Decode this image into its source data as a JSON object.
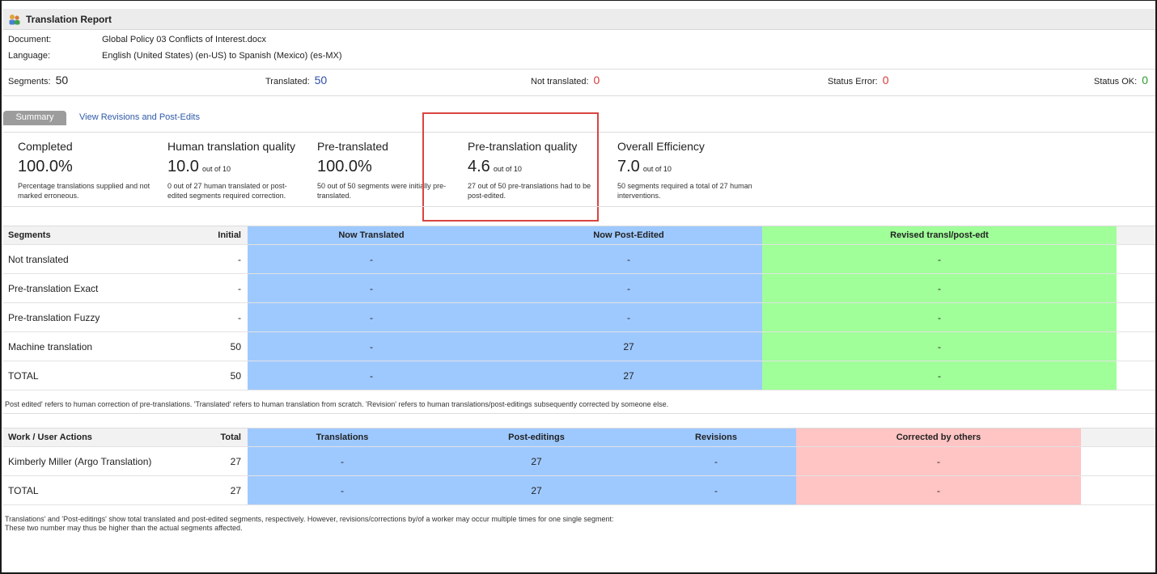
{
  "window": {
    "title": "Translation Report"
  },
  "info": {
    "document_label": "Document:",
    "document_value": "Global Policy 03 Conflicts of Interest.docx",
    "language_label": "Language:",
    "language_value": "English (United States) (en-US) to Spanish (Mexico) (es-MX)"
  },
  "stats": {
    "segments_label": "Segments:",
    "segments_value": "50",
    "translated_label": "Translated:",
    "translated_value": "50",
    "not_translated_label": "Not translated:",
    "not_translated_value": "0",
    "status_error_label": "Status Error:",
    "status_error_value": "0",
    "status_ok_label": "Status OK:",
    "status_ok_value": "0"
  },
  "tabs": {
    "summary": "Summary",
    "revisions_link": "View Revisions and Post-Edits"
  },
  "cards": [
    {
      "title": "Completed",
      "value": "100.0%",
      "suffix": "",
      "desc": "Percentage translations supplied and not marked erroneous."
    },
    {
      "title": "Human translation quality",
      "value": "10.0",
      "suffix": "out of 10",
      "desc": "0 out of 27 human translated or post-edited segments required correction."
    },
    {
      "title": "Pre-translated",
      "value": "100.0%",
      "suffix": "",
      "desc": "50 out of 50 segments were initially pre-translated."
    },
    {
      "title": "Pre-translation quality",
      "value": "4.6",
      "suffix": "out of 10",
      "desc": "27 out of 50 pre-translations had to be post-edited."
    },
    {
      "title": "Overall Efficiency",
      "value": "7.0",
      "suffix": "out of 10",
      "desc": "50 segments required a total of 27 human interventions."
    }
  ],
  "segments_table": {
    "headers": [
      "Segments",
      "Initial",
      "Now Translated",
      "Now Post-Edited",
      "Revised transl/post-edt"
    ],
    "rows": [
      [
        "Not translated",
        "-",
        "-",
        "-",
        "-"
      ],
      [
        "Pre-translation Exact",
        "-",
        "-",
        "-",
        "-"
      ],
      [
        "Pre-translation Fuzzy",
        "-",
        "-",
        "-",
        "-"
      ],
      [
        "Machine translation",
        "50",
        "-",
        "27",
        "-"
      ],
      [
        "TOTAL",
        "50",
        "-",
        "27",
        "-"
      ]
    ],
    "note": "Post edited' refers to human correction of pre-translations. 'Translated' refers to human translation from scratch. 'Revision' refers to human translations/post-editings subsequently corrected by someone else."
  },
  "work_table": {
    "headers": [
      "Work / User Actions",
      "Total",
      "Translations",
      "Post-editings",
      "Revisions",
      "Corrected by others"
    ],
    "rows": [
      [
        "Kimberly Miller (Argo Translation)",
        "27",
        "-",
        "27",
        "-",
        "-"
      ],
      [
        "TOTAL",
        "27",
        "-",
        "27",
        "-",
        "-"
      ]
    ],
    "note_line1": "Translations' and 'Post-editings' show total translated and post-edited segments, respectively. However, revisions/corrections by/of a worker may occur multiple times for one single segment:",
    "note_line2": "These two number may thus be higher than the actual segments affected."
  },
  "colors": {
    "blue": "#9ec9ff",
    "green": "#a0ff99",
    "pink": "#ffc4c4",
    "highlight": "#d9443f"
  }
}
